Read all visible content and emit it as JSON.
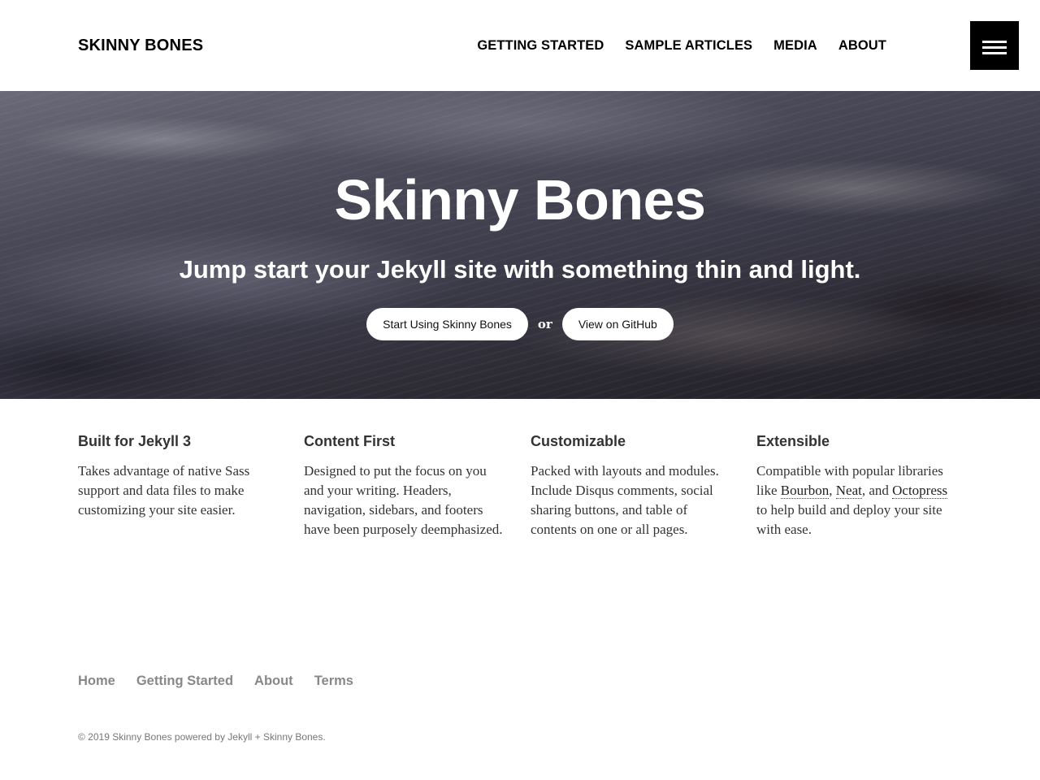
{
  "header": {
    "site_title": "SKINNY BONES",
    "nav": [
      {
        "label": "GETTING STARTED"
      },
      {
        "label": "SAMPLE ARTICLES"
      },
      {
        "label": "MEDIA"
      },
      {
        "label": "ABOUT"
      }
    ],
    "menu_icon": "hamburger-menu-icon"
  },
  "hero": {
    "title": "Skinny Bones",
    "subtitle": "Jump start your Jekyll site with something thin and light.",
    "primary_button": "Start Using Skinny Bones",
    "separator": "or",
    "secondary_button": "View on GitHub"
  },
  "features": [
    {
      "title": "Built for Jekyll 3",
      "text": "Takes advantage of native Sass support and data files to make customizing your site easier."
    },
    {
      "title": "Content First",
      "text": "Designed to put the focus on you and your writing. Headers, navigation, sidebars, and footers have been purposely deemphasized."
    },
    {
      "title": "Customizable",
      "text": "Packed with layouts and modules. Include Disqus comments, social sharing buttons, and table of contents on one or all pages."
    },
    {
      "title": "Extensible",
      "text_before": "Compatible with popular libraries like ",
      "links": [
        "Bourbon",
        "Neat",
        "Octopress"
      ],
      "sep1": ", ",
      "sep2": ", and ",
      "text_after": " to help build and deploy your site with ease."
    }
  ],
  "footer": {
    "nav": [
      {
        "label": "Home"
      },
      {
        "label": "Getting Started"
      },
      {
        "label": "About"
      },
      {
        "label": "Terms"
      }
    ],
    "copyright": "© 2019 Skinny Bones powered by Jekyll + Skinny Bones."
  },
  "colors": {
    "header_bg": "#ffffff",
    "menu_button_bg": "#000000",
    "footer_link": "#888888"
  }
}
